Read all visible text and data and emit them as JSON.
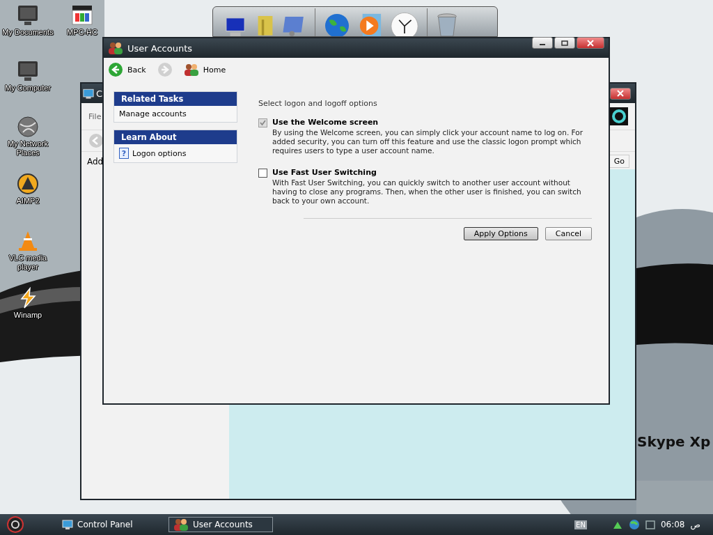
{
  "desktop": {
    "icons": [
      {
        "label": "My Documents",
        "kind": "monitor"
      },
      {
        "label": "MPC-HC",
        "kind": "clapper"
      },
      {
        "label": "My Computer",
        "kind": "monitor"
      },
      {
        "label": "My Network Places",
        "kind": "globe"
      },
      {
        "label": "AIMP2",
        "kind": "aimp"
      },
      {
        "label": "VLC media player",
        "kind": "cone"
      },
      {
        "label": "Winamp",
        "kind": "bolt"
      }
    ],
    "wallpaper_text": "Skype Xp"
  },
  "background_window": {
    "title": "C",
    "menu": [
      "File"
    ],
    "address_label": "Add",
    "go_button": "Go"
  },
  "window": {
    "title": "User Accounts",
    "nav": [
      {
        "label": "Back",
        "kind": "back",
        "disabled": false
      },
      {
        "kind": "forward",
        "disabled": true
      },
      {
        "label": "Home",
        "kind": "home",
        "disabled": false
      }
    ],
    "sidebar": [
      {
        "title": "Related Tasks",
        "items": [
          {
            "label": "Manage accounts",
            "kind": "task"
          }
        ]
      },
      {
        "title": "Learn About",
        "items": [
          {
            "label": "Logon options",
            "kind": "help",
            "icon": "?"
          }
        ]
      }
    ],
    "heading": "Select logon and logoff options",
    "options": [
      {
        "label": "Use the Welcome screen",
        "checked": true,
        "disabled": true,
        "description": "By using the Welcome screen, you can simply click your account name to log on. For added security, you can turn off this feature and use the classic logon prompt which requires users to type a user account name."
      },
      {
        "label": "Use Fast User Switching",
        "checked": false,
        "disabled": false,
        "description": "With Fast User Switching, you can quickly switch to another user account without having to close any programs. Then, when the other user is finished, you can switch back to your own account."
      }
    ],
    "buttons": [
      {
        "label": "Apply Options",
        "selected": true
      },
      {
        "label": "Cancel",
        "selected": false
      }
    ]
  },
  "taskbar": {
    "tasks": [
      {
        "label": "Control Panel",
        "selected": false,
        "kind": "panel"
      },
      {
        "label": "User Accounts",
        "selected": true,
        "kind": "users"
      }
    ],
    "language": "EN",
    "clock": "06:08",
    "period": "ص"
  }
}
